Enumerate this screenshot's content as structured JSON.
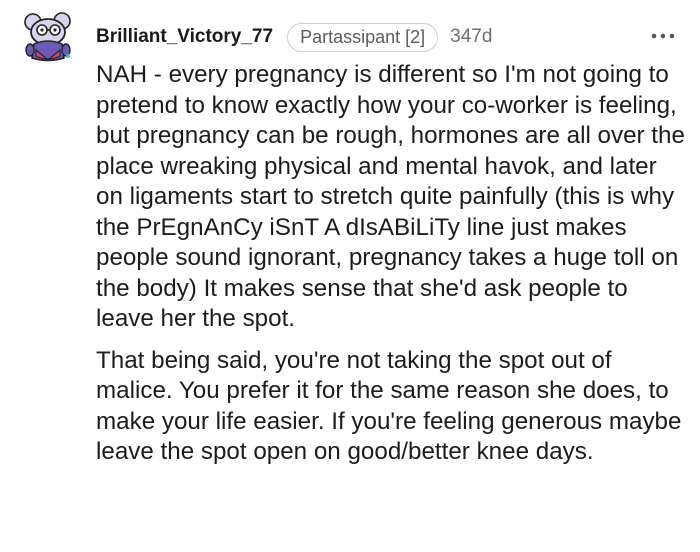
{
  "comment": {
    "username": "Brilliant_Victory_77",
    "flair": "Partassipant [2]",
    "timestamp": "347d",
    "more_icon": "more-horizontal-icon",
    "avatar_icon": "snoo-avatar-icon",
    "paragraphs": [
      "NAH - every pregnancy is different so I'm not going to pretend to know exactly how your co-worker is feeling, but pregnancy can be rough, hormones are all over the place wreaking physical and mental havok, and later on ligaments start to stretch quite painfully (this is why the PrEgnAnCy iSnT A dIsABiLiTy line just makes people sound ignorant, pregnancy takes a huge toll on the body) It makes sense that she'd ask people to leave her the spot.",
      "That being said, you're not taking the spot out of malice. You prefer it for the same reason she does, to make your life easier. If you're feeling generous maybe leave the spot open on good/better knee days."
    ]
  },
  "colors": {
    "text": "#1c1c1c",
    "muted": "#6e6e6e",
    "flair_border": "#cfcfcf",
    "avatar_body": "#6c5ab8",
    "avatar_shirt": "#d9457a"
  }
}
